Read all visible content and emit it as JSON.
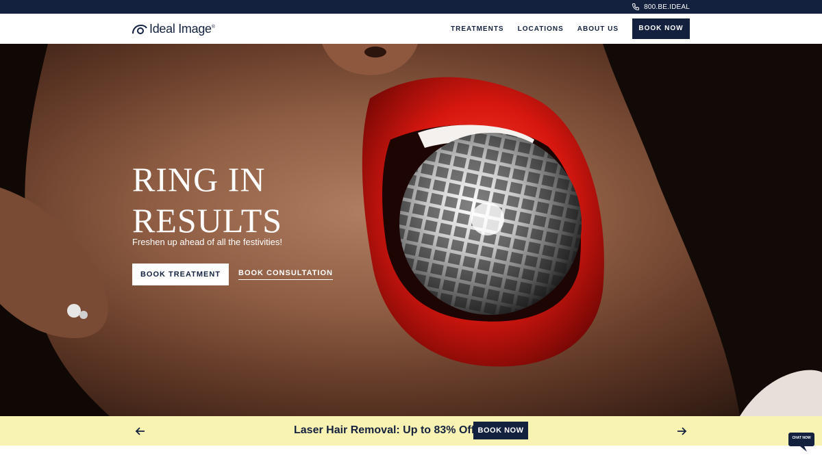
{
  "topbar": {
    "phone": "800.BE.IDEAL",
    "phone_icon": "phone-icon"
  },
  "header": {
    "logo_text": "Ideal Image",
    "logo_mark": "®",
    "nav": [
      "TREATMENTS",
      "LOCATIONS",
      "ABOUT US"
    ],
    "book_now": "BOOK NOW"
  },
  "hero": {
    "title": "RING IN RESULTS",
    "subtitle": "Freshen up ahead of all the festivities!",
    "btn_treatment": "BOOK TREATMENT",
    "btn_consult": "BOOK CONSULTATION"
  },
  "promo": {
    "text": "Laser Hair Removal: Up to 83% Off*",
    "button": "BOOK NOW",
    "prev_icon": "arrow-left-icon",
    "next_icon": "arrow-right-icon"
  },
  "chat": {
    "label": "CHAT NOW"
  },
  "colors": {
    "navy": "#13213f",
    "promo_bg": "#f8f2b3",
    "white": "#ffffff"
  }
}
